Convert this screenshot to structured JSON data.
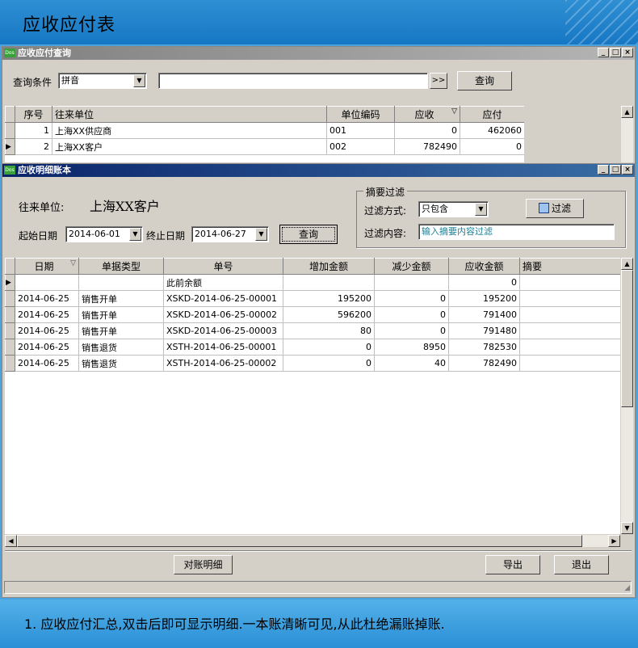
{
  "banner": {
    "title": "应收应付表"
  },
  "footer": {
    "text": "1. 应收应付汇总,双击后即可显示明细.一本账清晰可见,从此杜绝漏账掉账."
  },
  "query_window": {
    "title": "应收应付查询",
    "condition_label": "查询条件",
    "condition_value": "拼音",
    "search_value": "",
    "more_button": ">>",
    "query_button": "查询",
    "columns": [
      "序号",
      "往来单位",
      "单位编码",
      "应收",
      "应付"
    ],
    "sort_icon": "▽",
    "rows": [
      {
        "no": "1",
        "name": "上海XX供应商",
        "code": "001",
        "receivable": "0",
        "payable": "462060"
      },
      {
        "no": "2",
        "name": "上海XX客户",
        "code": "002",
        "receivable": "782490",
        "payable": "0"
      }
    ]
  },
  "detail_window": {
    "title": "应收明细账本",
    "partner_label": "往来单位:",
    "partner_value": "上海XX客户",
    "start_label": "起始日期",
    "start_value": "2014-06-01",
    "end_label": "终止日期",
    "end_value": "2014-06-27",
    "query_button": "查询",
    "filter_group": {
      "title": "摘要过滤",
      "mode_label": "过滤方式:",
      "mode_value": "只包含",
      "content_label": "过滤内容:",
      "content_placeholder": "输入摘要内容过滤",
      "filter_button": "过滤"
    },
    "columns": [
      "日期",
      "单据类型",
      "单号",
      "增加金额",
      "减少金额",
      "应收金额",
      "摘要"
    ],
    "sort_icon": "▽",
    "rows": [
      {
        "date": "",
        "type": "",
        "number": "此前余额",
        "increase": "",
        "decrease": "",
        "balance": "0",
        "memo": ""
      },
      {
        "date": "2014-06-25",
        "type": "销售开单",
        "number": "XSKD-2014-06-25-00001",
        "increase": "195200",
        "decrease": "0",
        "balance": "195200",
        "memo": ""
      },
      {
        "date": "2014-06-25",
        "type": "销售开单",
        "number": "XSKD-2014-06-25-00002",
        "increase": "596200",
        "decrease": "0",
        "balance": "791400",
        "memo": ""
      },
      {
        "date": "2014-06-25",
        "type": "销售开单",
        "number": "XSKD-2014-06-25-00003",
        "increase": "80",
        "decrease": "0",
        "balance": "791480",
        "memo": ""
      },
      {
        "date": "2014-06-25",
        "type": "销售退货",
        "number": "XSTH-2014-06-25-00001",
        "increase": "0",
        "decrease": "8950",
        "balance": "782530",
        "memo": ""
      },
      {
        "date": "2014-06-25",
        "type": "销售退货",
        "number": "XSTH-2014-06-25-00002",
        "increase": "0",
        "decrease": "40",
        "balance": "782490",
        "memo": ""
      }
    ],
    "reconcile_button": "对账明细",
    "export_button": "导出",
    "exit_button": "退出"
  },
  "colors": {
    "titlebar_active": "#0a246a",
    "titlebar_inactive": "#808080",
    "window_bg": "#d4d0c8"
  }
}
